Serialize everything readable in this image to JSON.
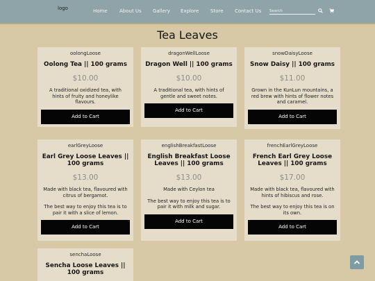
{
  "header": {
    "logo": "logo",
    "nav": [
      "Home",
      "About Us",
      "Gallery",
      "Explore",
      "Store",
      "Contact Us"
    ],
    "search_placeholder": "Search"
  },
  "page_title": "Tea Leaves",
  "products": [
    {
      "sku": "oolongLoose",
      "name": "Oolong Tea || 100 grams",
      "price": "$10.00",
      "desc": "A traditional oxidized tea, with hints of fruity and honeylike flavours.",
      "desc2": "",
      "button": "Add to Cart"
    },
    {
      "sku": "dragonWellLoose",
      "name": "Dragon Well || 100 grams",
      "price": "$10.00",
      "desc": "A traditional tea, with hints of gentle and sweet notes.",
      "desc2": "",
      "button": "Add to Cart"
    },
    {
      "sku": "snowDaisyLoose",
      "name": "Snow Daisy || 100 grams",
      "price": "$11.00",
      "desc": "Grown in the KunLun mountains, a red brew with hints of flower notes and caramel.",
      "desc2": "",
      "button": "Add to Cart"
    },
    {
      "sku": "earlGreyLoose",
      "name": "Earl Grey Loose Leaves || 100 grams",
      "price": "$13.00",
      "desc": "Made with black tea, flavoured with citrus of bergamot.",
      "desc2": "The best way to enjoy this tea is to pair it with a slice of lemon.",
      "button": "Add to Cart"
    },
    {
      "sku": "englishBreakfastLoose",
      "name": "English Breakfast Loose Leaves || 100 grams",
      "price": "$13.00",
      "desc": "Made with Ceylon tea",
      "desc2": "The best way to enjoy this tea is to pair it with milk and sugar.",
      "button": "Add to Cart"
    },
    {
      "sku": "frenchEarlGreyLoose",
      "name": "French Earl Grey Loose Leaves || 100 grams",
      "price": "$17.00",
      "desc": "Made with black tea, flavoured with hints of hibiscus and rose.",
      "desc2": "The best way to enjoy this tea is on its own.",
      "button": "Add to Cart"
    },
    {
      "sku": "senchaLoose",
      "name": "Sencha Loose Leaves || 100 grams",
      "price": "",
      "desc": "",
      "desc2": "",
      "button": ""
    }
  ]
}
